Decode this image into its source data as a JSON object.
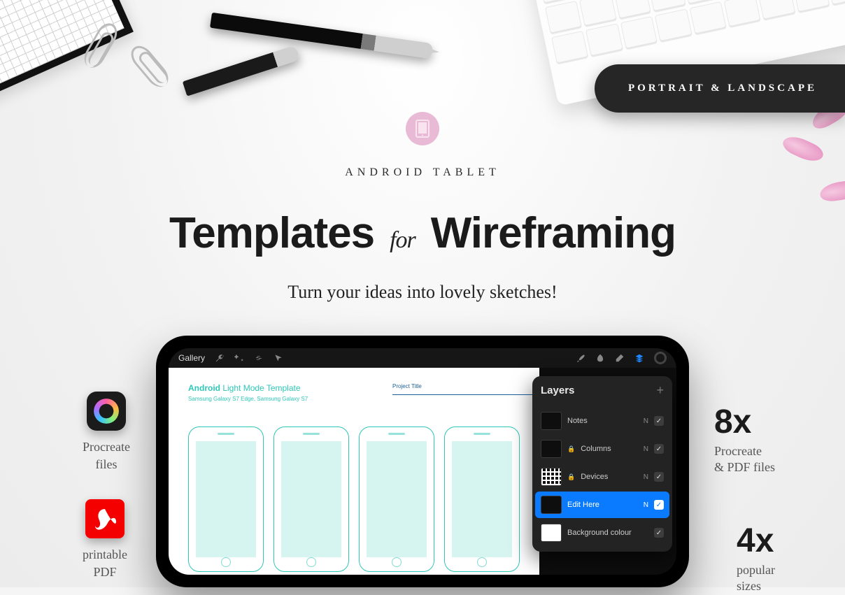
{
  "badge": "PORTRAIT & LANDSCAPE",
  "hero": {
    "eyebrow": "ANDROID TABLET",
    "title_left": "Templates",
    "title_for": "for",
    "title_right": "Wireframing",
    "subtitle": "Turn your ideas into lovely sketches!"
  },
  "procreate": {
    "gallery": "Gallery",
    "template_title_bold": "Android",
    "template_title_rest": "Light Mode Template",
    "template_subtitle": "Samsung Galaxy S7 Edge, Samsung Galaxy S7",
    "project_label": "Project Title"
  },
  "layers": {
    "header": "Layers",
    "rows": [
      {
        "name": "Notes",
        "locked": false,
        "selected": false
      },
      {
        "name": "Columns",
        "locked": true,
        "selected": false
      },
      {
        "name": "Devices",
        "locked": true,
        "selected": false
      },
      {
        "name": "Edit Here",
        "locked": false,
        "selected": true
      },
      {
        "name": "Background colour",
        "locked": false,
        "selected": false
      }
    ]
  },
  "features_left": {
    "a_line1": "Procreate",
    "a_line2": "files",
    "b_line1": "printable",
    "b_line2": "PDF"
  },
  "features_right": {
    "a_big": "8x",
    "a_line1": "Procreate",
    "a_line2": "& PDF files",
    "b_big": "4x",
    "b_line1": "popular",
    "b_line2": "sizes"
  }
}
